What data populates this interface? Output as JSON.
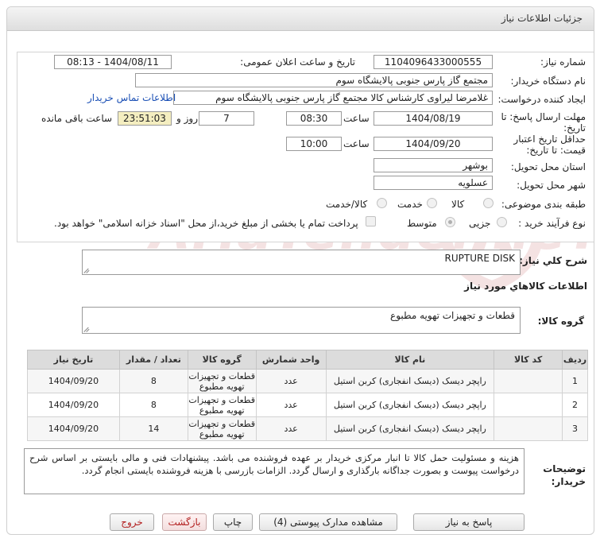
{
  "panel": {
    "title": "جزئیات اطلاعات نیاز"
  },
  "form": {
    "need_number_label": "شماره نیاز:",
    "need_number": "1104096433000555",
    "announce_label": "تاریخ و ساعت اعلان عمومی:",
    "announce_value": "1404/08/11 - 08:13",
    "buyer_org_label": "نام دستگاه خریدار:",
    "buyer_org": "مجتمع گاز پارس جنوبی  پالایشگاه سوم",
    "creator_label": "ایجاد کننده درخواست:",
    "creator": "غلامرضا لیراوی کارشناس کالا مجتمع گاز پارس جنوبی  پالایشگاه سوم",
    "contact_link": "اطلاعات تماس خریدار",
    "reply_deadline_label": "مهلت ارسال پاسخ: تا تاریخ:",
    "reply_date": "1404/08/19",
    "hour_label": "ساعت",
    "reply_time": "08:30",
    "days_value": "7",
    "days_label": "روز و",
    "remaining_time": "23:51:03",
    "remaining_label": "ساعت باقی مانده",
    "validity_label": "حداقل تاریخ اعتبار قیمت: تا تاریخ:",
    "validity_date": "1404/09/20",
    "validity_time": "10:00",
    "province_label": "استان محل تحویل:",
    "province": "بوشهر",
    "city_label": "شهر محل تحویل:",
    "city": "عسلویه",
    "category_label": "طبقه بندی موضوعی:",
    "category_options": [
      "کالا",
      "خدمت",
      "کالا/خدمت"
    ],
    "purchase_type_label": "نوع فرآیند خرید :",
    "purchase_options": [
      "جزیی",
      "متوسط"
    ],
    "payment_note": "پرداخت تمام یا بخشی از مبلغ خرید،از محل \"اسناد خزانه اسلامی\" خواهد بود."
  },
  "description": {
    "label": "شرح کلي نياز:",
    "value": "RUPTURE DISK"
  },
  "goods_info": {
    "title": "اطلاعات کالاهاي مورد نياز",
    "group_label": "گروه کالا:",
    "group_value": "قطعات و تجهیزات تهویه مطبوع"
  },
  "table": {
    "headers": [
      "ردیف",
      "کد کالا",
      "نام کالا",
      "واحد شمارش",
      "گروه کالا",
      "تعداد / مقدار",
      "تاریخ نیاز"
    ],
    "rows": [
      [
        "1",
        "",
        "راپچر دیسک (دیسک انفجاری) کربن استیل",
        "عدد",
        "قطعات و تجهیزات تهویه مطبوع",
        "8",
        "1404/09/20"
      ],
      [
        "2",
        "",
        "راپچر دیسک (دیسک انفجاری) کربن استیل",
        "عدد",
        "قطعات و تجهیزات تهویه مطبوع",
        "8",
        "1404/09/20"
      ],
      [
        "3",
        "",
        "راپچر دیسک (دیسک انفجاری) کربن استیل",
        "عدد",
        "قطعات و تجهیزات تهویه مطبوع",
        "14",
        "1404/09/20"
      ]
    ]
  },
  "notes": {
    "label": "توضیحات خریدار:",
    "value": "هزینه و مسئولیت حمل کالا تا انبار مرکزی خریدار بر عهده فروشنده می باشد. پیشنهادات فنی و مالی بایستی بر اساس شرح درخواست پیوست و بصورت جداگانه بارگذاری و ارسال گردد. الزامات بازرسی با هزینه فروشنده بایستی انجام گردد."
  },
  "buttons": {
    "reply": "پاسخ به نیاز",
    "attachments": "مشاهده مدارک پیوستی (4)",
    "print": "چاپ",
    "back": "بازگشت",
    "exit": "خروج"
  },
  "watermark": {
    "text": "AriaTender.neT"
  }
}
